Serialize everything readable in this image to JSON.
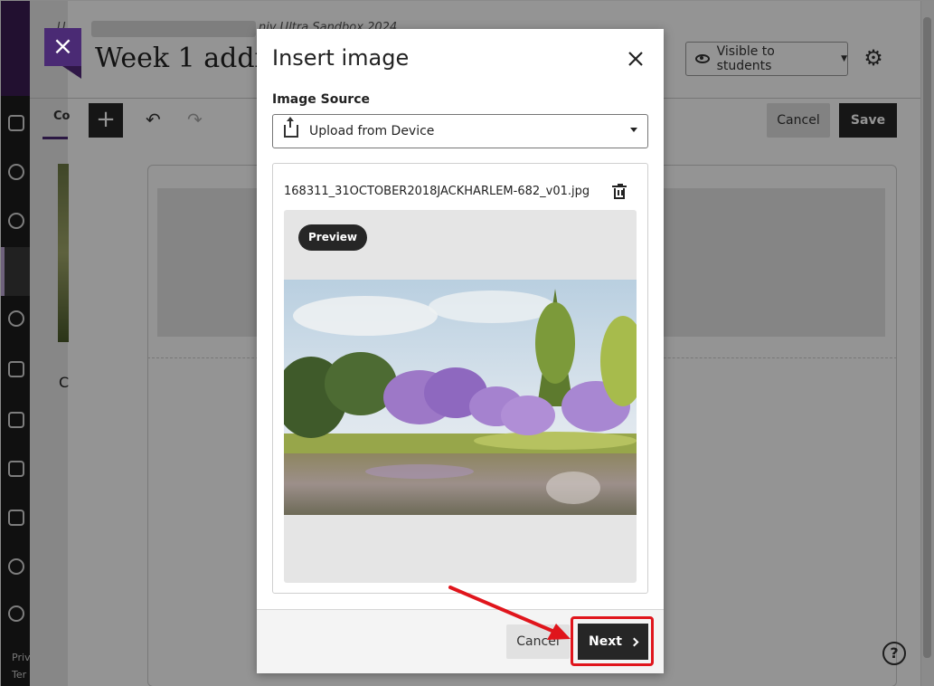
{
  "background": {
    "breadcrumb_start": "U",
    "breadcrumb_end": "niv Ultra Sandbox 2024",
    "page_title": "Week 1 additi",
    "content_tab": "Co",
    "visibility_label": "Visible to students",
    "cancel_label": "Cancel",
    "save_label": "Save",
    "outline_letter": "C",
    "nav_footer_1": "Priv",
    "nav_footer_2": "Ter"
  },
  "modal": {
    "title": "Insert image",
    "image_source_label": "Image Source",
    "image_source_value": "Upload from Device",
    "file_name": "168311_31OCTOBER2018JACKHARLEM-682_v01.jpg",
    "preview_badge": "Preview",
    "cancel_label": "Cancel",
    "next_label": "Next"
  },
  "colors": {
    "accent_purple": "#4a2a74",
    "button_dark": "#262626",
    "annotation_red": "#e0151c"
  },
  "icons": [
    "close-icon",
    "eye-icon",
    "gear-icon",
    "plus-icon",
    "undo-icon",
    "redo-icon",
    "upload-icon",
    "chevron-down-icon",
    "trash-icon",
    "chevron-right-icon",
    "help-icon"
  ]
}
